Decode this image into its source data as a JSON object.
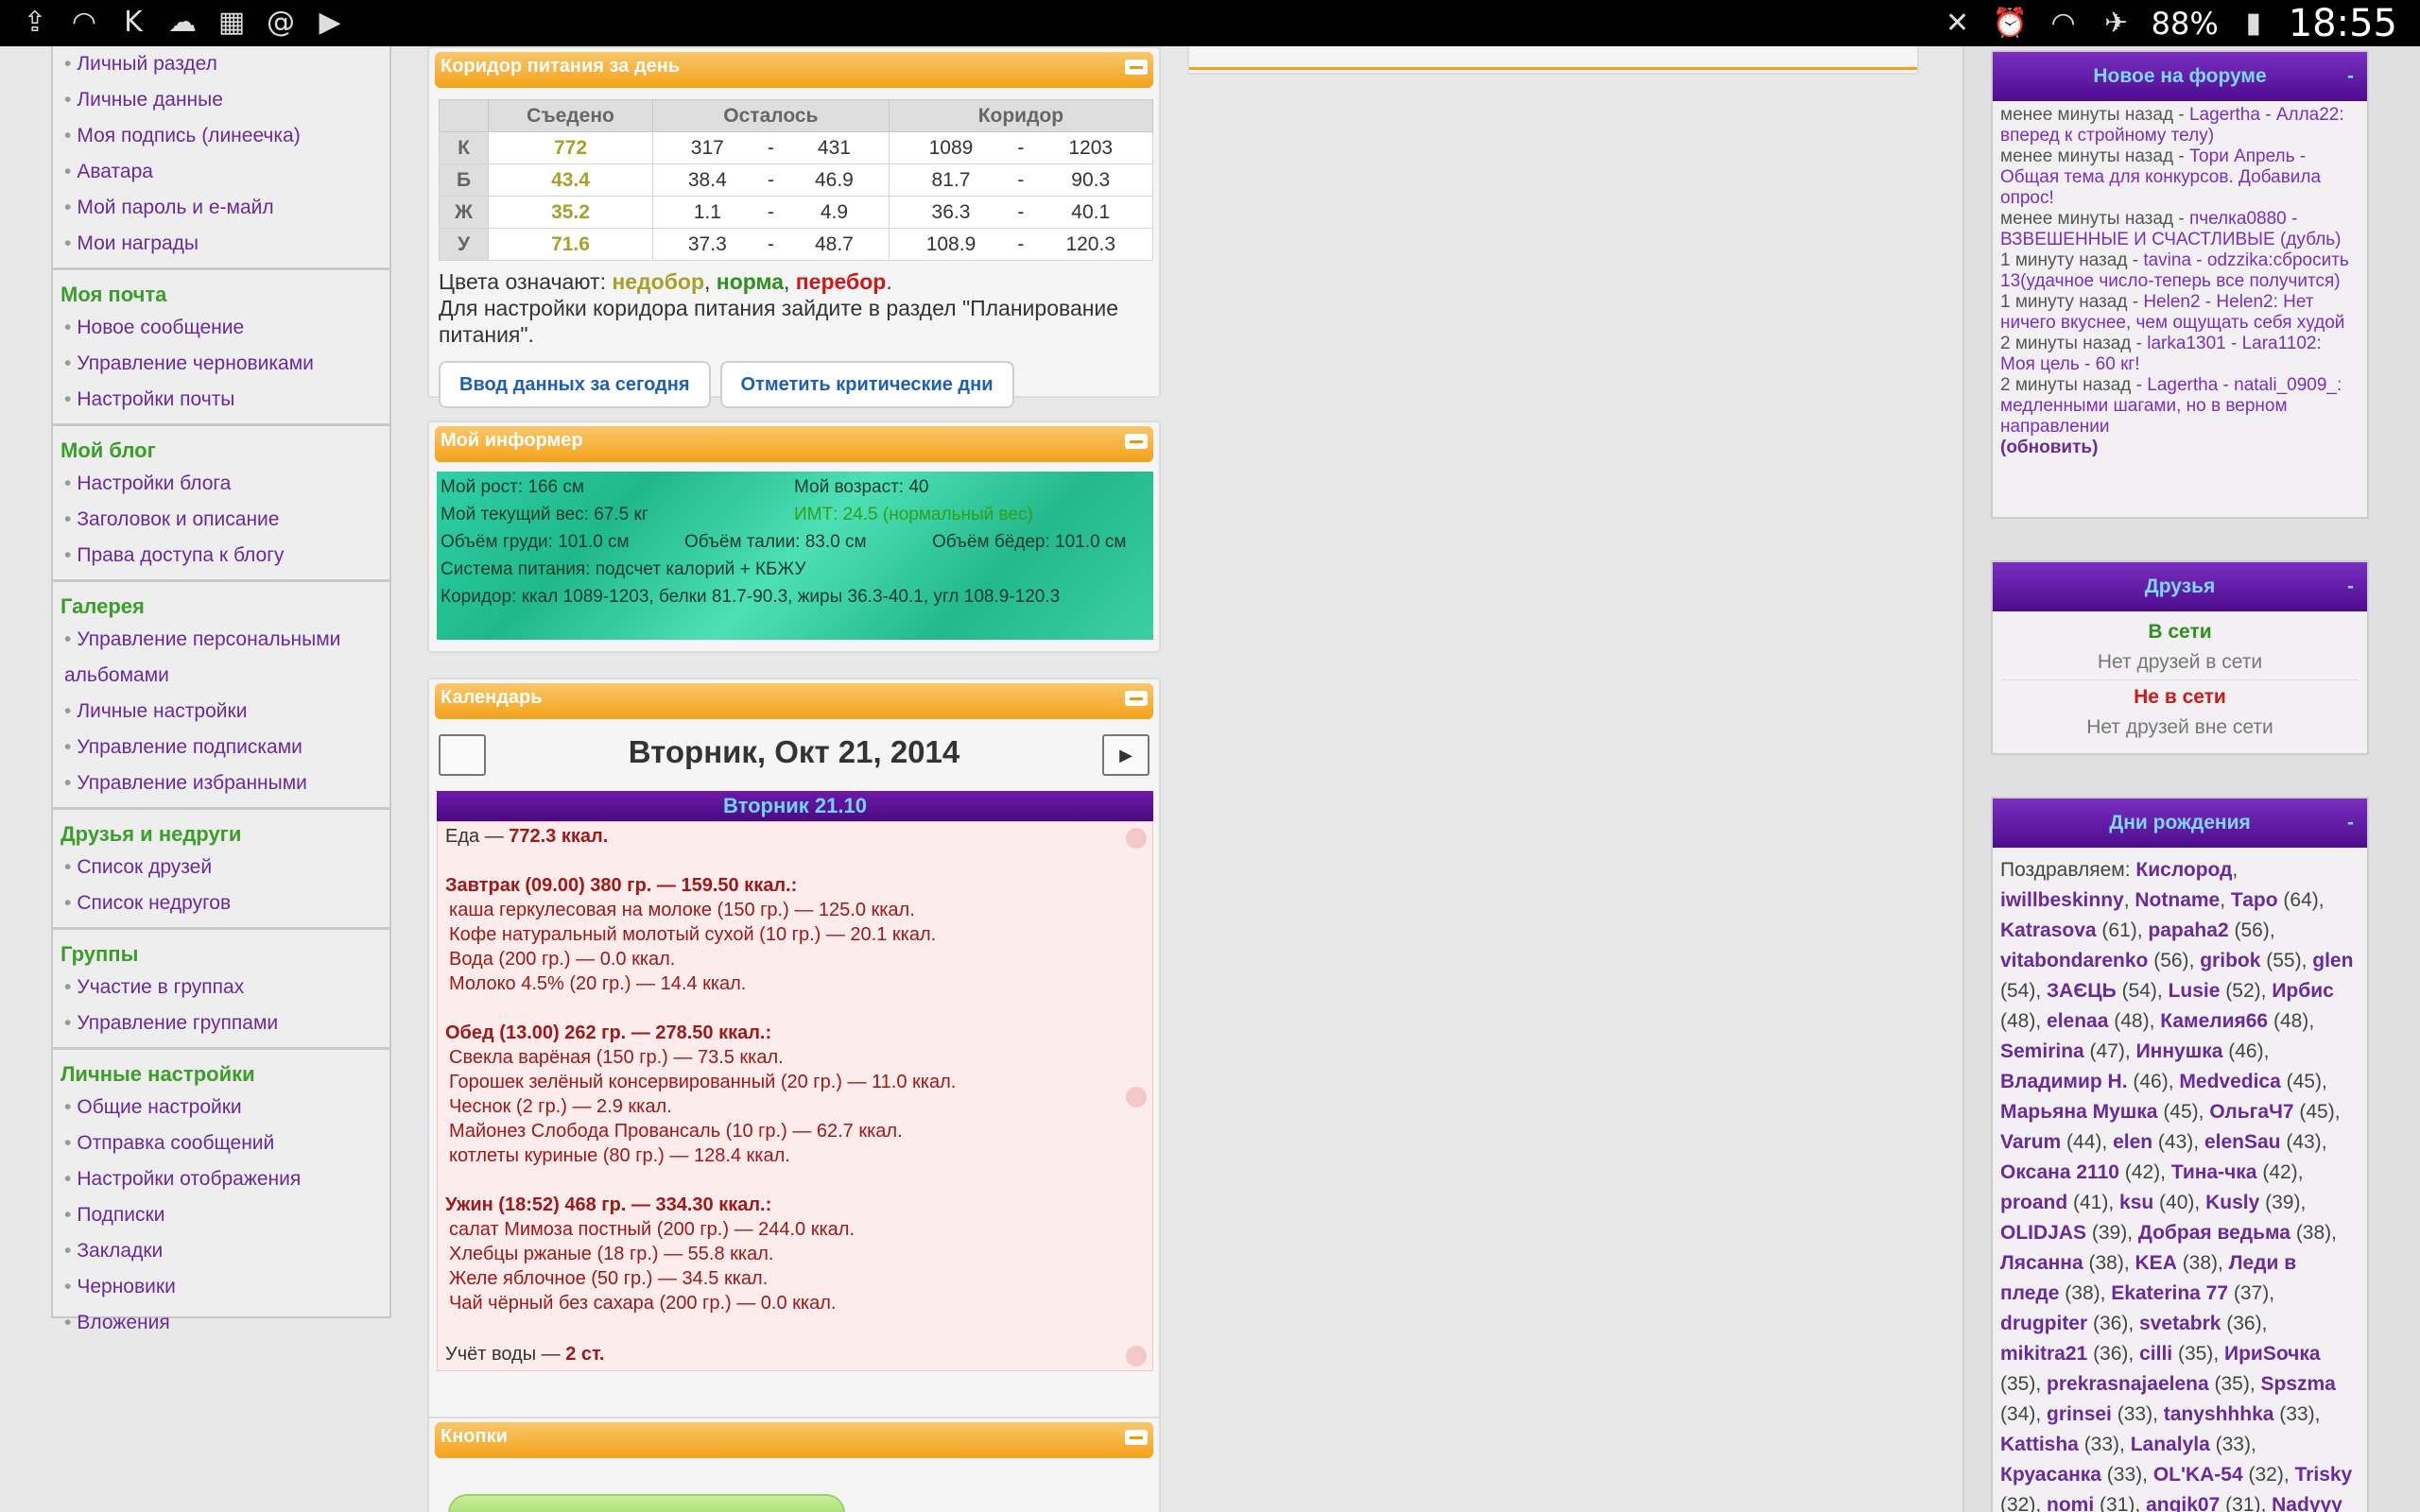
{
  "statusbar": {
    "left_icons": [
      "upload-icon",
      "wifi-icon",
      "app-k-icon",
      "cloud-icon",
      "app-photo-icon",
      "at-icon",
      "youtube-icon"
    ],
    "battery": "88%",
    "time": "18:55"
  },
  "left_menu": {
    "sections": [
      {
        "title": "",
        "items": [
          "Личный раздел",
          "Личные данные",
          "Моя подпись (линеечка)",
          "Аватара",
          "Мой пароль и е-майл",
          "Мои награды"
        ]
      },
      {
        "title": "Моя почта",
        "items": [
          "Новое сообщение",
          "Управление черновиками",
          "Настройки почты"
        ]
      },
      {
        "title": "Мой блог",
        "items": [
          "Настройки блога",
          "Заголовок и описание",
          "Права доступа к блогу"
        ]
      },
      {
        "title": "Галерея",
        "items": [
          "Управление персональными альбомами",
          "Личные настройки",
          "Управление подписками",
          "Управление избранными"
        ]
      },
      {
        "title": "Друзья и недруги",
        "items": [
          "Список друзей",
          "Список недругов"
        ]
      },
      {
        "title": "Группы",
        "items": [
          "Участие в группах",
          "Управление группами"
        ]
      },
      {
        "title": "Личные настройки",
        "items": [
          "Общие настройки",
          "Отправка сообщений",
          "Настройки отображения",
          "Подписки",
          "Закладки",
          "Черновики",
          "Вложения"
        ]
      }
    ]
  },
  "corridor": {
    "title": "Коридор питания за день",
    "headers": [
      "Съедено",
      "Осталось",
      "Коридор"
    ],
    "rows": [
      {
        "label": "К",
        "eaten": "772",
        "left_min": "317",
        "left_max": "431",
        "cor_min": "1089",
        "cor_max": "1203"
      },
      {
        "label": "Б",
        "eaten": "43.4",
        "left_min": "38.4",
        "left_max": "46.9",
        "cor_min": "81.7",
        "cor_max": "90.3"
      },
      {
        "label": "Ж",
        "eaten": "35.2",
        "left_min": "1.1",
        "left_max": "4.9",
        "cor_min": "36.3",
        "cor_max": "40.1"
      },
      {
        "label": "У",
        "eaten": "71.6",
        "left_min": "37.3",
        "left_max": "48.7",
        "cor_min": "108.9",
        "cor_max": "120.3"
      }
    ],
    "dash": "-",
    "legend_prefix": "Цвета означают: ",
    "legend_under": "недобор",
    "legend_norm": "норма",
    "legend_over": "перебор",
    "note": "Для настройки коридора питания зайдите в раздел \"Планирование питания\".",
    "button_today": "Ввод данных за сегодня",
    "button_critical": "Отметить критические дни"
  },
  "informer": {
    "title": "Мой информер",
    "height": "Мой рост: 166 см",
    "age": "Мой возраст: 40",
    "weight": "Мой текущий вес: 67.5 кг",
    "bmi": "ИМТ: 24.5 (нормальный вес)",
    "chest": "Объём груди: 101.0 см",
    "waist": "Объём талии: 83.0 см",
    "hips": "Объём бёдер: 101.0 см",
    "system": "Система питания: подсчет калорий + КБЖУ",
    "corridor": "Коридор: ккал 1089-1203, белки 81.7-90.3, жиры 36.3-40.1, угл 108.9-120.3"
  },
  "calendar": {
    "title": "Календарь",
    "date": "Вторник, Окт 21, 2014",
    "next": "▶",
    "day_header": "Вторник 21.10",
    "food_prefix": "Еда — ",
    "food_total": "772.3 ккал.",
    "meals": [
      {
        "title": "Завтрак (09.00) 380 гр. — 159.50 ккал.:",
        "items": [
          "каша геркулесовая на молоке (150 гр.) — 125.0 ккал.",
          "Кофе натуральный молотый сухой (10 гр.) — 20.1 ккал.",
          "Вода (200 гр.) — 0.0 ккал.",
          "Молоко 4.5% (20 гр.) — 14.4 ккал."
        ]
      },
      {
        "title": "Обед (13.00) 262 гр. — 278.50 ккал.:",
        "items": [
          "Свекла варёная (150 гр.) — 73.5 ккал.",
          "Горошек зелёный консервированный (20 гр.) — 11.0 ккал.",
          "Чеснок (2 гр.) — 2.9 ккал.",
          "Майонез Слобода Провансаль (10 гр.) — 62.7 ккал.",
          "котлеты куриные (80 гр.) — 128.4 ккал."
        ]
      },
      {
        "title": "Ужин (18:52) 468 гр. — 334.30 ккал.:",
        "items": [
          "салат Мимоза постный (200 гр.) — 244.0 ккал.",
          "Хлебцы ржаные (18 гр.) — 55.8 ккал.",
          "Желе яблочное (50 гр.) — 34.5 ккал.",
          "Чай чёрный без сахара (200 гр.) — 0.0 ккал."
        ]
      }
    ],
    "water_prefix": "Учёт воды — ",
    "water_value": "2 ст."
  },
  "buttons_box": {
    "title": "Кнопки"
  },
  "forum": {
    "title": "Новое на форуме",
    "collapse": "-",
    "entries": [
      {
        "time": "менее минуты назад - ",
        "link": "Lagertha - Алла22: вперед к стройному телу)"
      },
      {
        "time": "менее минуты назад - ",
        "link": "Тори Апрель - Общая тема для конкурсов. Добавила опрос!"
      },
      {
        "time": "менее минуты назад - ",
        "link": "пчелка0880 - ВЗВЕШЕННЫЕ И СЧАСТЛИВЫЕ (дубль)"
      },
      {
        "time": "1 минуту назад - ",
        "link": "tavina - odzzika:сбросить 13(удачное число-теперь все получится)"
      },
      {
        "time": "1 минуту назад - ",
        "link": "Helen2 - Helen2: Нет ничего вкуснее, чем ощущать себя худой"
      },
      {
        "time": "2 минуты назад - ",
        "link": "larka1301 - Lara1102: Моя цель - 60 кг!"
      },
      {
        "time": "2 минуты назад - ",
        "link": "Lagertha - natali_0909_: медленными шагами, но в верном направлении"
      }
    ],
    "refresh": "(обновить)"
  },
  "friends": {
    "title": "Друзья",
    "collapse": "-",
    "online": "В сети",
    "online_none": "Нет друзей в сети",
    "offline": "Не в сети",
    "offline_none": "Нет друзей вне сети"
  },
  "birthdays": {
    "title": "Дни рождения",
    "collapse": "-",
    "prefix": "Поздравляем: ",
    "people": [
      [
        "Кислород",
        ""
      ],
      [
        "iwillbeskinny",
        ""
      ],
      [
        "Notname",
        ""
      ],
      [
        "Таро",
        " (64)"
      ],
      [
        "Katrasova",
        " (61)"
      ],
      [
        "papaha2",
        " (56)"
      ],
      [
        "vitabondarenko",
        " (56)"
      ],
      [
        "gribok",
        " (55)"
      ],
      [
        "glen",
        " (54)"
      ],
      [
        "ЗАЄЦЬ",
        " (54)"
      ],
      [
        "Lusie",
        " (52)"
      ],
      [
        "Ирбис",
        " (48)"
      ],
      [
        "elenaa",
        " (48)"
      ],
      [
        "Камелия66",
        " (48)"
      ],
      [
        "Semirina",
        " (47)"
      ],
      [
        "Иннушка",
        " (46)"
      ],
      [
        "Владимир Н.",
        " (46)"
      ],
      [
        "Medvedica",
        " (45)"
      ],
      [
        "Марьяна Мушка",
        " (45)"
      ],
      [
        "ОльгаЧ7",
        " (45)"
      ],
      [
        "Varum",
        " (44)"
      ],
      [
        "elen",
        " (43)"
      ],
      [
        "elenSau",
        " (43)"
      ],
      [
        "Оксана 2110",
        " (42)"
      ],
      [
        "Тина-чка",
        " (42)"
      ],
      [
        "proand",
        " (41)"
      ],
      [
        "ksu",
        " (40)"
      ],
      [
        "Kusly",
        " (39)"
      ],
      [
        "OLIDJAS",
        " (39)"
      ],
      [
        "Добрая ведьма",
        " (38)"
      ],
      [
        "Лясанна",
        " (38)"
      ],
      [
        "KEA",
        " (38)"
      ],
      [
        "Леди в пледе",
        " (38)"
      ],
      [
        "Ekaterina 77",
        " (37)"
      ],
      [
        "drugpiter",
        " (36)"
      ],
      [
        "svetabrk",
        " (36)"
      ],
      [
        "mikitra21",
        " (36)"
      ],
      [
        "cilli",
        " (35)"
      ],
      [
        "ИриSочка",
        " (35)"
      ],
      [
        "prekrasnajaelena",
        " (35)"
      ],
      [
        "Spszma",
        " (34)"
      ],
      [
        "grinsei",
        " (33)"
      ],
      [
        "tanyshhhka",
        " (33)"
      ],
      [
        "Kattisha",
        " (33)"
      ],
      [
        "Lanalyla",
        " (33)"
      ],
      [
        "Круасанка",
        " (33)"
      ],
      [
        "OL'KA-54",
        " (32)"
      ],
      [
        "Trisky",
        " (32)"
      ],
      [
        "nomi",
        " (31)"
      ],
      [
        "angik07",
        " (31)"
      ],
      [
        "Nadyyy",
        ""
      ]
    ]
  }
}
